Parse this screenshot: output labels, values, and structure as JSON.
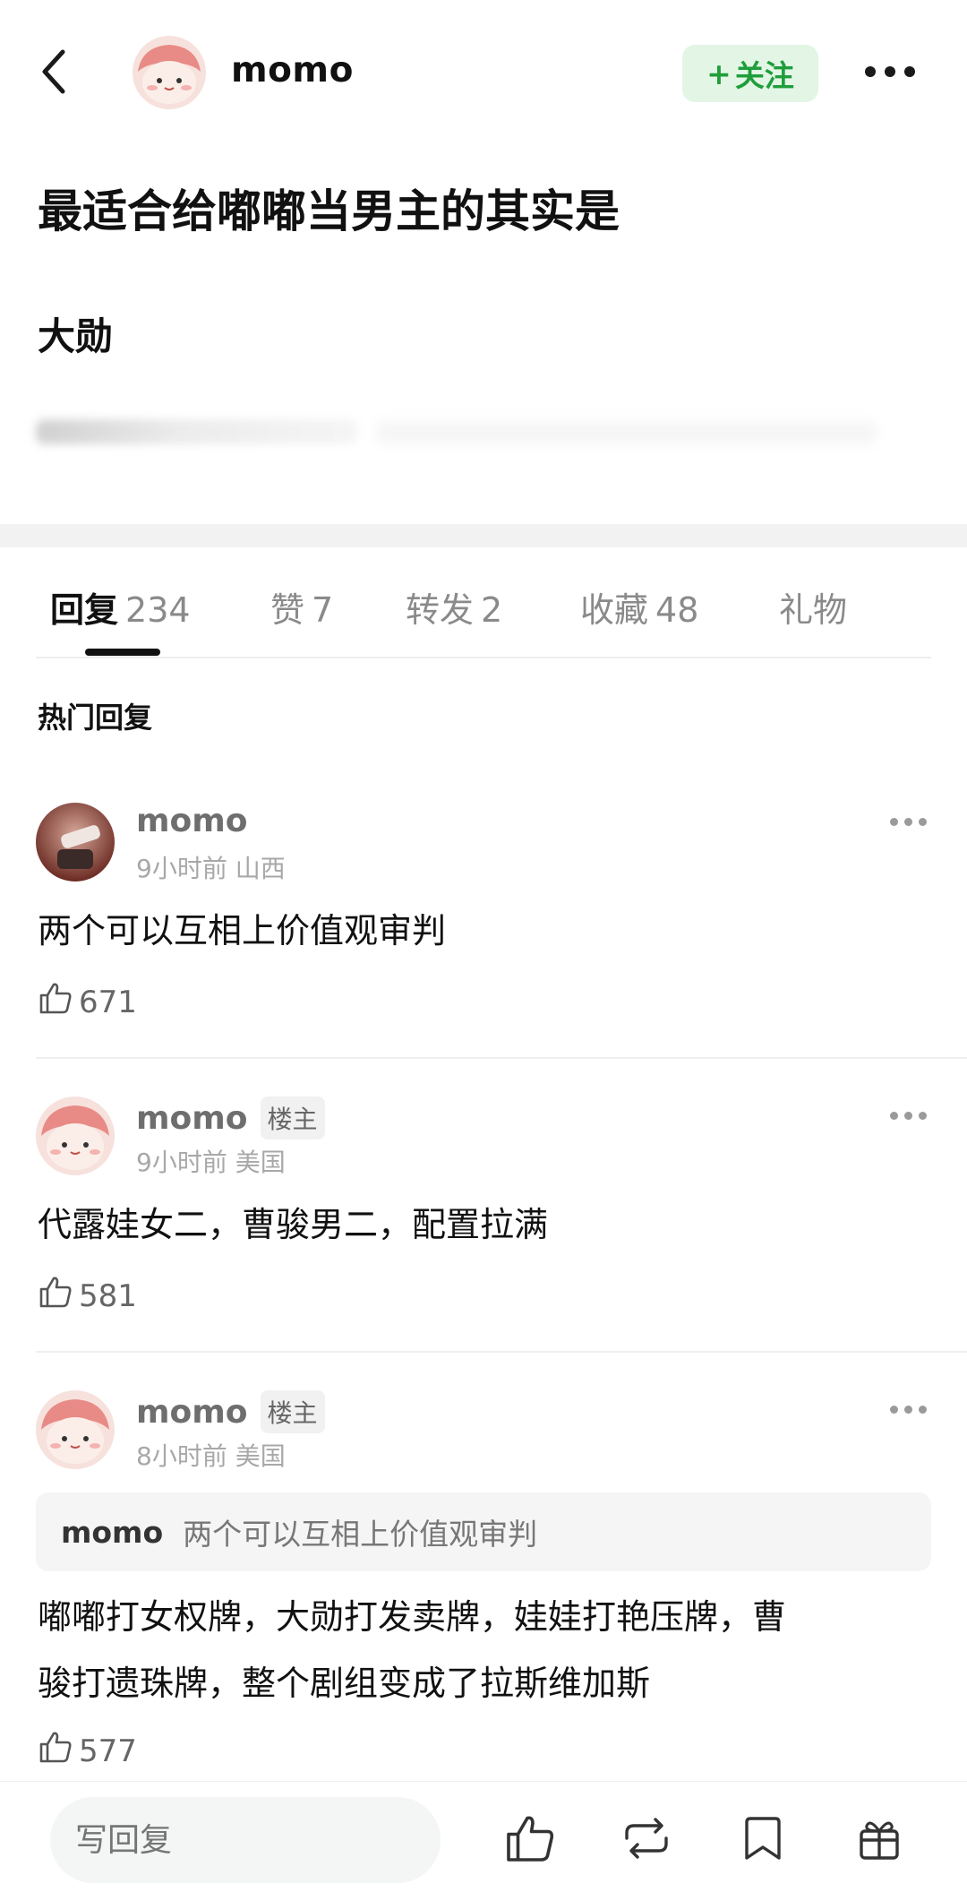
{
  "header": {
    "username": "momo",
    "follow_label": "关注",
    "follow_plus": "+"
  },
  "post": {
    "title": "最适合给嘟嘟当男主的其实是",
    "body": "大勋"
  },
  "tabs": [
    {
      "label": "回复",
      "count": "234",
      "active": true
    },
    {
      "label": "赞",
      "count": "7"
    },
    {
      "label": "转发",
      "count": "2"
    },
    {
      "label": "收藏",
      "count": "48"
    },
    {
      "label": "礼物",
      "count": ""
    }
  ],
  "hot_replies_title": "热门回复",
  "comments": [
    {
      "name": "momo",
      "badge": "",
      "time": "9小时前",
      "location": "山西",
      "text": "两个可以互相上价值观审判",
      "likes": "671"
    },
    {
      "name": "momo",
      "badge": "楼主",
      "time": "9小时前",
      "location": "美国",
      "text": "代露娃女二，曹骏男二，配置拉满",
      "likes": "581"
    },
    {
      "name": "momo",
      "badge": "楼主",
      "time": "8小时前",
      "location": "美国",
      "quote_name": "momo",
      "quote_text": "两个可以互相上价值观审判",
      "text_line1": "嘟嘟打女权牌，大勋打发卖牌，娃娃打艳压牌，曹",
      "text_line2": "骏打遗珠牌，整个剧组变成了拉斯维加斯",
      "likes": "577"
    }
  ],
  "bottom_bar": {
    "reply_placeholder": "写回复",
    "icons": [
      "like-icon",
      "repost-icon",
      "bookmark-icon",
      "gift-icon"
    ]
  },
  "colors": {
    "follow_bg": "#e3f6e6",
    "follow_text": "#1f9e3b",
    "meta_gray": "#a8a8a8"
  }
}
